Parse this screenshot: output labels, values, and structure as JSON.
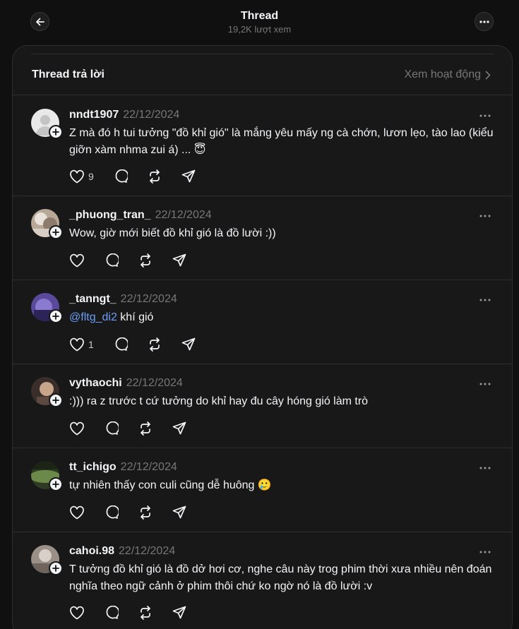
{
  "header": {
    "title": "Thread",
    "subtitle": "19,2K lượt xem"
  },
  "replies_section": {
    "title": "Thread trả lời",
    "activity_link": "Xem hoạt động"
  },
  "posts": [
    {
      "username": "nndt1907",
      "date": "22/12/2024",
      "text": "Z mà đó h tui tưởng \"đồ khỉ gió\" là mắng yêu mấy ng cà chớn, lươn lẹo, tào lao (kiểu giỡn xàm nhma zui á) ... 😇",
      "likes": "9"
    },
    {
      "username": "_phuong_tran_",
      "date": "22/12/2024",
      "text": "Wow, giờ mới biết đồ khỉ gió là đồ lười :))",
      "likes": ""
    },
    {
      "username": "_tanngt_",
      "date": "22/12/2024",
      "mention": "@fltg_di2",
      "text": " khí gió",
      "likes": "1"
    },
    {
      "username": "vythaochi",
      "date": "22/12/2024",
      "text": ":))) ra z trước t cứ tưởng do khỉ hay đu cây hóng gió làm trò",
      "likes": ""
    },
    {
      "username": "tt_ichigo",
      "date": "22/12/2024",
      "text": "tự nhiên thấy con culi cũng dễ huông 🥲",
      "likes": ""
    },
    {
      "username": "cahoi.98",
      "date": "22/12/2024",
      "text": "T tưởng đồ khỉ gió là đồ dở hơi cơ, nghe câu này trog phim thời xưa nhiều nên đoán nghĩa theo ngữ cảnh ở phim thôi chứ ko ngờ nó là đồ lười :v",
      "likes": ""
    }
  ],
  "colors": {
    "background": "#101010",
    "panel": "#181818",
    "border": "#2e2e2e",
    "text_primary": "#f3f5f7",
    "text_secondary": "#777777",
    "mention": "#6c9ef8"
  },
  "icons": [
    "arrow-left-icon",
    "more-horizontal-icon",
    "chevron-right-icon",
    "heart-icon",
    "comment-icon",
    "repost-icon",
    "share-icon",
    "plus-icon"
  ]
}
